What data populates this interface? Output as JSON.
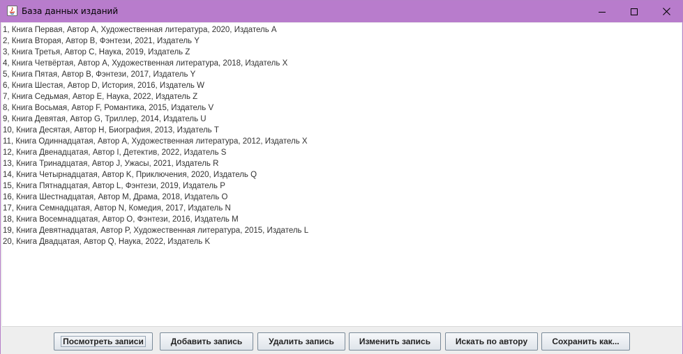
{
  "window": {
    "title": "База данных изданий",
    "controls": {
      "minimize": "minimize-icon",
      "maximize": "maximize-icon",
      "close": "close-icon"
    },
    "title_bar_color": "#b87ccc"
  },
  "records": [
    "1, Книга Первая, Автор A, Художественная литература, 2020, Издатель A",
    "2, Книга Вторая, Автор B, Фэнтези, 2021, Издатель Y",
    "3, Книга Третья, Автор C, Наука, 2019, Издатель Z",
    "4, Книга Четвёртая, Автор A, Художественная литература, 2018, Издатель X",
    "5, Книга Пятая, Автор B, Фэнтези, 2017, Издатель Y",
    "6, Книга Шестая, Автор D, История, 2016, Издатель W",
    "7, Книга Седьмая, Автор E, Наука, 2022, Издатель Z",
    "8, Книга Восьмая, Автор F, Романтика, 2015, Издатель V",
    "9, Книга Девятая, Автор G, Триллер, 2014, Издатель U",
    "10, Книга Десятая, Автор H, Биография, 2013, Издатель T",
    "11, Книга Одиннадцатая, Автор A, Художественная литература, 2012, Издатель X",
    "12, Книга Двенадцатая, Автор I, Детектив, 2022, Издатель S",
    "13, Книга Тринадцатая, Автор J, Ужасы, 2021, Издатель R",
    "14, Книга Четырнадцатая, Автор K, Приключения, 2020, Издатель Q",
    "15, Книга Пятнадцатая, Автор L, Фэнтези, 2019, Издатель P",
    "16, Книга Шестнадцатая, Автор M, Драма, 2018, Издатель O",
    "17, Книга Семнадцатая, Автор N, Комедия, 2017, Издатель N",
    "18, Книга Восемнадцатая, Автор O, Фэнтези, 2016, Издатель M",
    "19, Книга Девятнадцатая, Автор P, Художественная литература, 2015, Издатель L",
    "20, Книга Двадцатая, Автор Q, Наука, 2022, Издатель K"
  ],
  "buttons": {
    "view": "Посмотреть записи",
    "add": "Добавить запись",
    "delete": "Удалить запись",
    "edit": "Изменить запись",
    "search_author": "Искать по автору",
    "save_as": "Сохранить как..."
  }
}
